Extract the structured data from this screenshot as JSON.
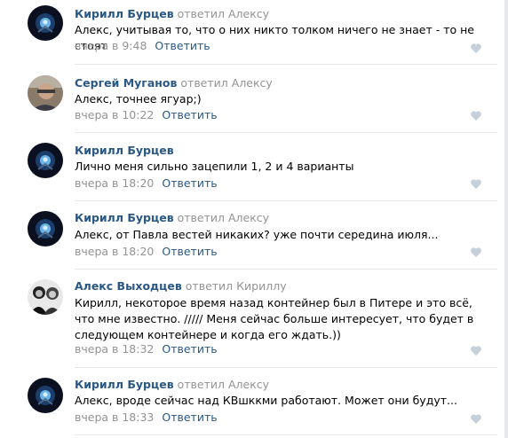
{
  "comments": [
    {
      "author": "Кирилл Бурцев",
      "replied": "ответил",
      "target": "Алексу",
      "text": "Алекс, учитывая то, что о них никто толком ничего не знает - то не стоят",
      "date": "вчера в 9:48",
      "reply_label": "Ответить",
      "avatar": "rocket-avatar"
    },
    {
      "author": "Сергей Муганов",
      "replied": "ответил",
      "target": "Алексу",
      "text": "Алекс, точнее ягуар;)",
      "date": "вчера в 10:22",
      "reply_label": "Ответить",
      "avatar": "photo-avatar"
    },
    {
      "author": "Кирилл Бурцев",
      "replied": "",
      "target": "",
      "text": "Лично меня сильно зацепили 1, 2 и 4 варианты",
      "date": "вчера в 18:20",
      "reply_label": "Ответить",
      "avatar": "rocket-avatar"
    },
    {
      "author": "Кирилл Бурцев",
      "replied": "ответил",
      "target": "Алексу",
      "text": "Алекс, от Павла вестей никаких? уже почти середина июля...",
      "date": "вчера в 18:20",
      "reply_label": "Ответить",
      "avatar": "rocket-avatar"
    },
    {
      "author": "Алекс Выходцев",
      "replied": "ответил",
      "target": "Кириллу",
      "text": "Кирилл, некоторое время назад контейнер был в Питере и это всё, что мне известно. ///// Меня сейчас больше интересует, что будет в следующем контейнере и когда его ждать.))",
      "date": "вчера в 18:32",
      "reply_label": "Ответить",
      "avatar": "bw-photo-avatar"
    },
    {
      "author": "Кирилл Бурцев",
      "replied": "ответил",
      "target": "Алексу",
      "text": "Алекс, вроде сейчас над КВшккми работают. Может они будут...",
      "date": "вчера в 18:33",
      "reply_label": "Ответить",
      "avatar": "rocket-avatar"
    }
  ],
  "like_icon": "heart-icon"
}
